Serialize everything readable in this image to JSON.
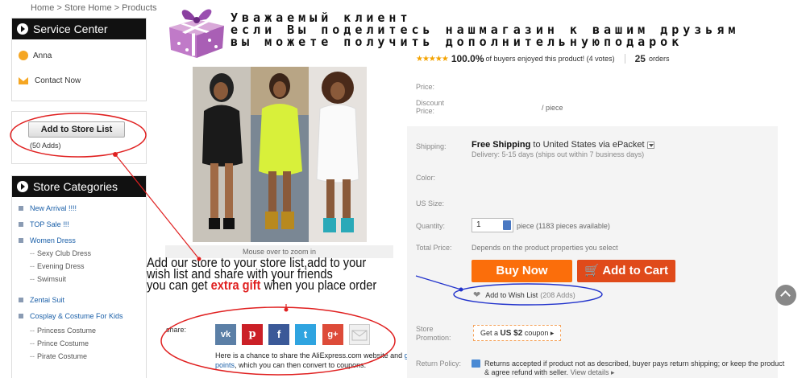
{
  "breadcrumb": "Home > Store Home > Products",
  "sidebar": {
    "service_title": "Service Center",
    "contact_name": "Anna",
    "contact_now": "Contact Now",
    "add_store_label": "Add to Store List",
    "store_adds": "(50 Adds)",
    "categories_title": "Store Categories",
    "categories": [
      {
        "label": "New Arrival !!!!"
      },
      {
        "label": "TOP Sale !!!"
      },
      {
        "label": "Women Dress"
      },
      {
        "label": "Sexy Club Dress"
      },
      {
        "label": "Evening Dress"
      },
      {
        "label": "Swimsuit"
      },
      {
        "label": "Zentai Suit"
      },
      {
        "label": "Cosplay & Costume For Kids"
      },
      {
        "label": "Princess Costume"
      },
      {
        "label": "Prince Costume"
      },
      {
        "label": "Pirate Costume"
      }
    ]
  },
  "banner": {
    "line1": "Уважаемый клиент",
    "line2": "если Вы поделитесь нашмагазин к вашим друзьям",
    "line3": "вы можете получить дополнительнуюподарок"
  },
  "product": {
    "zoom_hint": "Mouse over to zoom in"
  },
  "annotation": {
    "line1": "Add our store to your store list,add to your",
    "line2": "wish list and share with your friends",
    "line3_pre": "you can get ",
    "line3_gift": "extra gift",
    "line3_post": " when you place order"
  },
  "share": {
    "label": "share:",
    "vk": "vk",
    "pinterest": "p",
    "facebook": "f",
    "twitter": "t",
    "google": "g+",
    "desc_pre": "Here is a chance to share the AliExpress.com website and ",
    "desc_link": "get points",
    "desc_post": ", which you can then convert to coupons."
  },
  "rating": {
    "stars": "★★★★★",
    "percent": "100.0%",
    "text": "of buyers enjoyed this product! (4 votes)",
    "orders_count": "25",
    "orders_label": "orders"
  },
  "details": {
    "price_label": "Price:",
    "discount_label": "Discount Price:",
    "per_piece": "/ piece",
    "shipping_label": "Shipping:",
    "ship_free": "Free Shipping",
    "ship_to": " to ",
    "ship_dest": "United States via ePacket",
    "ship_delivery": "Delivery: 5-15 days (ships out within 7 business days)",
    "color_label": "Color:",
    "size_label": "US Size:",
    "quantity_label": "Quantity:",
    "quantity_value": "1",
    "quantity_info": "piece (1183 pieces available)",
    "total_label": "Total Price:",
    "total_info": "Depends on the product properties you select",
    "buy_now": "Buy Now",
    "add_to_cart": "Add to Cart",
    "wish_label": "Add to Wish List",
    "wish_count": "(208 Adds)",
    "promo_label": "Store Promotion:",
    "coupon_pre": "Get a ",
    "coupon_amt": "US $2",
    "coupon_post": " coupon ▸",
    "return_label": "Return Policy:",
    "return_text": "Returns accepted if product not as described, buyer pays return shipping; or keep the product & agree refund with seller.",
    "view_details": "View details ▸"
  },
  "colors": {
    "accent_orange": "#fb6e0b",
    "cart_red": "#e04a1a",
    "annotation_red": "#e02020",
    "annotation_blue": "#2233cc"
  }
}
